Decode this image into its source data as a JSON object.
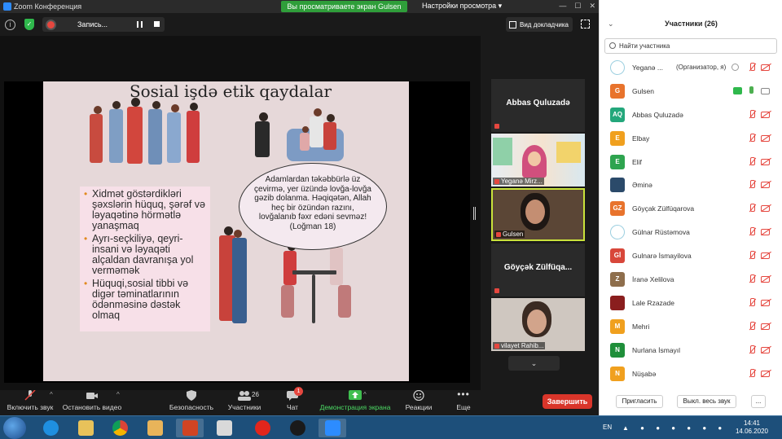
{
  "window": {
    "title": "Zoom Конференция",
    "share_banner": "Вы просматриваете экран Gulsen",
    "view_options": "Настройки просмотра"
  },
  "topbar": {
    "recording_label": "Запись...",
    "speaker_view_label": "Вид докладчика"
  },
  "slide": {
    "title": "Sosial işdə etik qaydalar",
    "bullets": [
      "Xidmət göstərdikləri şəxslərin hüquq, şərəf və ləyaqətinə hörmətlə yanaşmaq",
      "Ayrı-seçkiliyə, qeyri-insani və ləyaqəti alçaldan davranışa yol verməmək",
      "Hüquqi,sosial tibbi və digər təminatlarının ödənməsinə dəstək olmaq"
    ],
    "quote": "Adamlardan təkəbbürlə üz çevirmə, yer üzündə lovğa-lovğa gəzib dolanma. Həqiqətən, Allah heç bir özündən razını, lovğalanıb fəxr edəni sevməz!(Loğman 18)"
  },
  "thumbnails": [
    {
      "big_name": "Abbas Quluzadə",
      "label": ""
    },
    {
      "big_name": "",
      "label": "Yeganə Mirz..."
    },
    {
      "big_name": "",
      "label": "Gulsen"
    },
    {
      "big_name": "Göyçək Zülfüqa...",
      "label": ""
    },
    {
      "big_name": "",
      "label": "vilayet Rahib..."
    }
  ],
  "toolbar": {
    "mute_label": "Включить звук",
    "video_label": "Остановить видео",
    "security_label": "Безопасность",
    "participants_label": "Участники",
    "participants_count": "26",
    "chat_label": "Чат",
    "chat_badge": "1",
    "share_label": "Демонстрация экрана",
    "reactions_label": "Реакции",
    "more_label": "Еще",
    "end_label": "Завершить"
  },
  "panel": {
    "title": "Участники (26)",
    "search_placeholder": "Найти участника",
    "invite_label": "Пригласить",
    "mute_all_label": "Выкл. весь звук",
    "more_label": "...",
    "participants": [
      {
        "initials": "",
        "name": "Yeganə ...",
        "role": "(Организатор, я)",
        "color": "#ffffff",
        "logo": true
      },
      {
        "initials": "G",
        "name": "Gulsen",
        "role": "",
        "color": "#e8732c",
        "sharing": true
      },
      {
        "initials": "AQ",
        "name": "Abbas Quluzadə",
        "role": "",
        "color": "#23a77b"
      },
      {
        "initials": "E",
        "name": "Elbay",
        "role": "",
        "color": "#f0a01e"
      },
      {
        "initials": "E",
        "name": "Elif",
        "role": "",
        "color": "#2ea44f"
      },
      {
        "initials": "",
        "name": "Əminə",
        "role": "",
        "color": "#2b4a6a",
        "photo": true
      },
      {
        "initials": "GZ",
        "name": "Göyçak Zülfüqarova",
        "role": "",
        "color": "#e8732c"
      },
      {
        "initials": "",
        "name": "Gülnar Rüstəmova",
        "role": "",
        "color": "#ffffff",
        "logo": true
      },
      {
        "initials": "Gİ",
        "name": "Gulnarə İsmayilova",
        "role": "",
        "color": "#d8473a"
      },
      {
        "initials": "Z",
        "name": "İranə Xelilova",
        "role": "",
        "color": "#8e6e4c"
      },
      {
        "initials": "",
        "name": "Lale Rzazade",
        "role": "",
        "color": "#8a1e1e",
        "photo": true
      },
      {
        "initials": "M",
        "name": "Mehri",
        "role": "",
        "color": "#f0a01e"
      },
      {
        "initials": "N",
        "name": "Nurlana İsmayıl",
        "role": "",
        "color": "#1f8f3a"
      },
      {
        "initials": "N",
        "name": "Nüşabə",
        "role": "",
        "color": "#f0a01e"
      }
    ]
  },
  "taskbar": {
    "language": "EN",
    "time": "14:41",
    "date": "14.06.2020"
  }
}
